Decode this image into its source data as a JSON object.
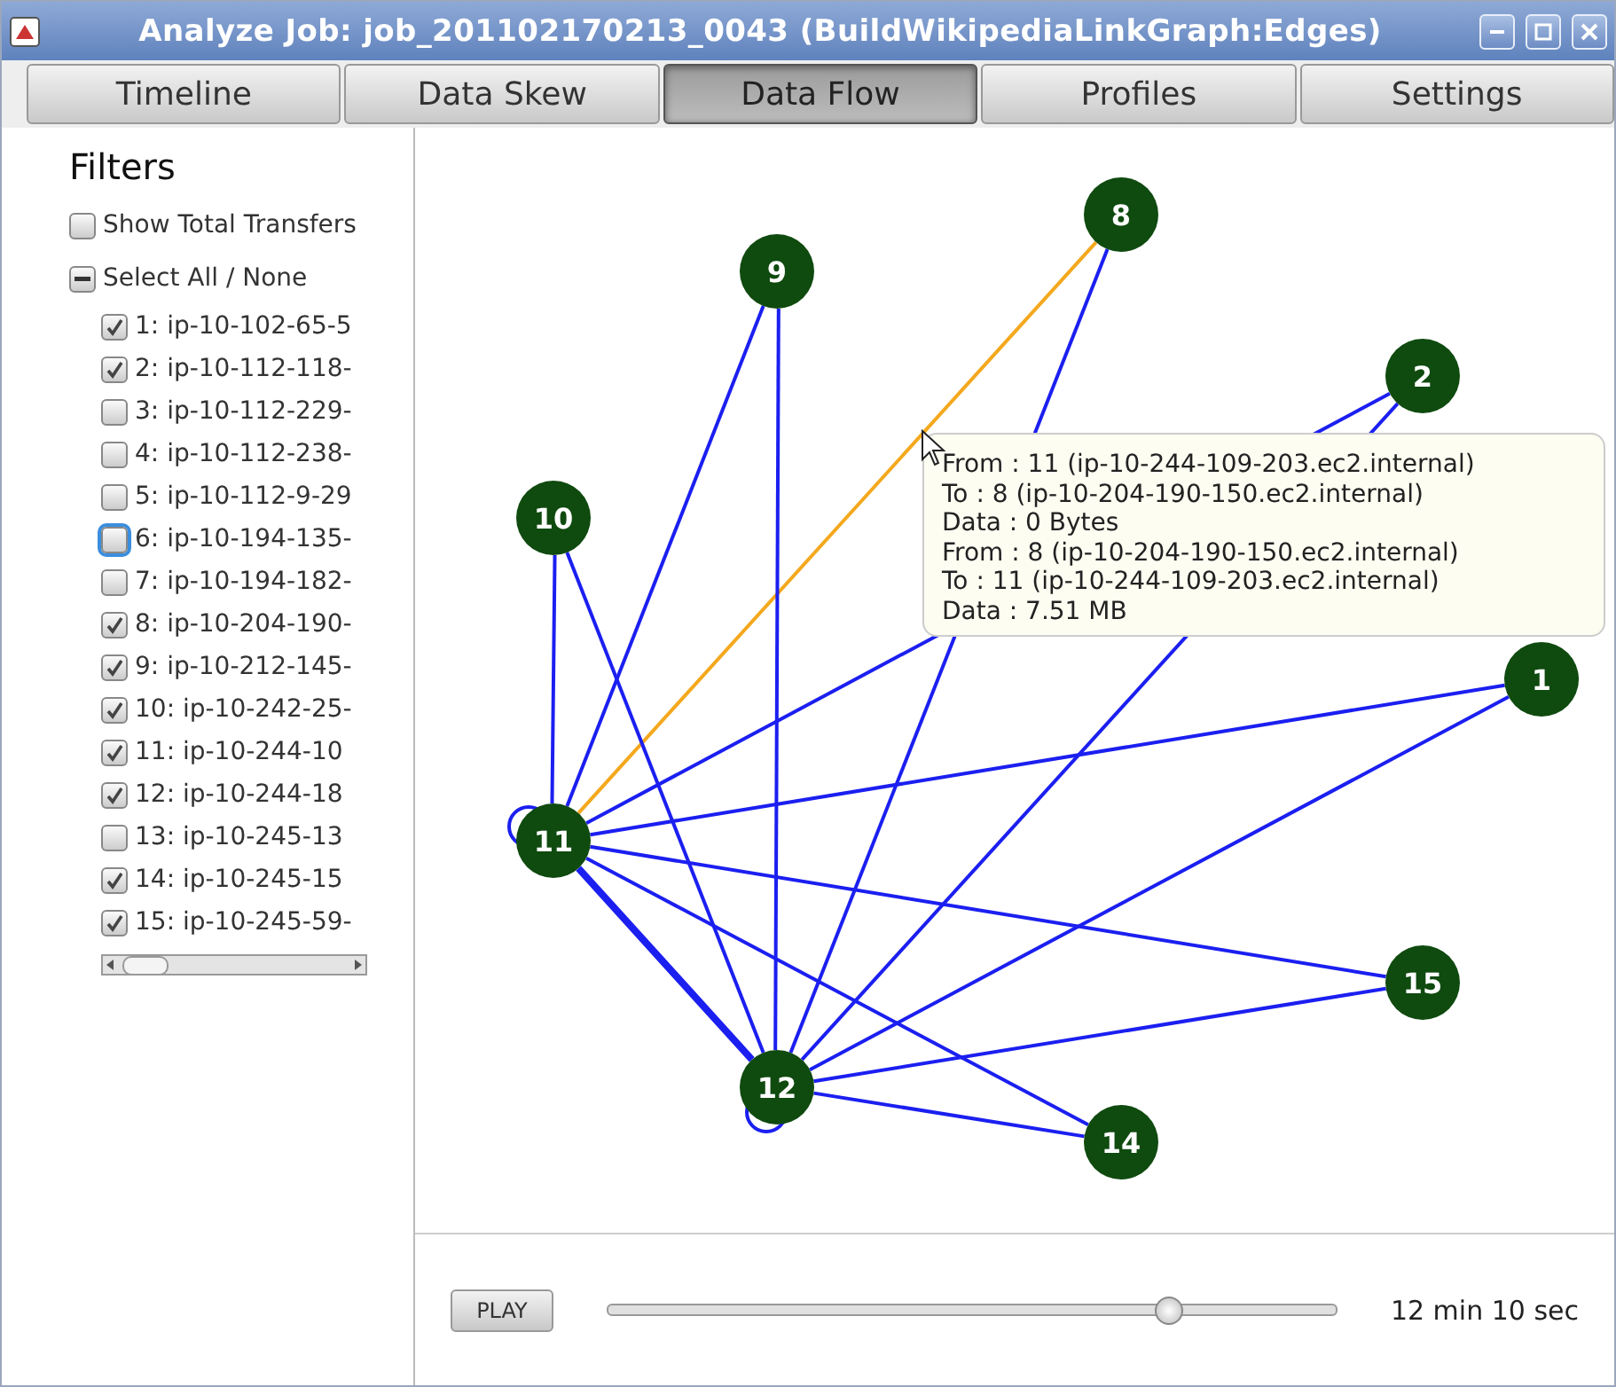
{
  "window": {
    "title": "Analyze Job: job_201102170213_0043 (BuildWikipediaLinkGraph:Edges)"
  },
  "tabs": [
    {
      "label": "Timeline",
      "selected": false
    },
    {
      "label": "Data Skew",
      "selected": false
    },
    {
      "label": "Data Flow",
      "selected": true
    },
    {
      "label": "Profiles",
      "selected": false
    },
    {
      "label": "Settings",
      "selected": false
    }
  ],
  "filters": {
    "title": "Filters",
    "show_total": {
      "label": "Show Total Transfers",
      "checked": false
    },
    "select_all": {
      "label": "Select All / None",
      "kind": "mixed"
    },
    "hosts": [
      {
        "label": "1: ip-10-102-65-5",
        "checked": true,
        "focused": false
      },
      {
        "label": "2: ip-10-112-118-",
        "checked": true,
        "focused": false
      },
      {
        "label": "3: ip-10-112-229-",
        "checked": false,
        "focused": false
      },
      {
        "label": "4: ip-10-112-238-",
        "checked": false,
        "focused": false
      },
      {
        "label": "5: ip-10-112-9-29",
        "checked": false,
        "focused": false
      },
      {
        "label": "6: ip-10-194-135-",
        "checked": false,
        "focused": true
      },
      {
        "label": "7: ip-10-194-182-",
        "checked": false,
        "focused": false
      },
      {
        "label": "8: ip-10-204-190-",
        "checked": true,
        "focused": false
      },
      {
        "label": "9: ip-10-212-145-",
        "checked": true,
        "focused": false
      },
      {
        "label": "10: ip-10-242-25-",
        "checked": true,
        "focused": false
      },
      {
        "label": "11: ip-10-244-10",
        "checked": true,
        "focused": false
      },
      {
        "label": "12: ip-10-244-18",
        "checked": true,
        "focused": false
      },
      {
        "label": "13: ip-10-245-13",
        "checked": false,
        "focused": false
      },
      {
        "label": "14: ip-10-245-15",
        "checked": true,
        "focused": false
      },
      {
        "label": "15: ip-10-245-59-",
        "checked": true,
        "focused": false
      }
    ]
  },
  "graph": {
    "nodes": [
      {
        "label": "8"
      },
      {
        "label": "9"
      },
      {
        "label": "2"
      },
      {
        "label": "10"
      },
      {
        "label": "1"
      },
      {
        "label": "11"
      },
      {
        "label": "15"
      },
      {
        "label": "12"
      },
      {
        "label": "14"
      }
    ],
    "edges": [
      {
        "kind": "line",
        "selected": true
      },
      {
        "kind": "line",
        "selected": false
      },
      {
        "kind": "line",
        "selected": false
      },
      {
        "kind": "line",
        "selected": false
      },
      {
        "kind": "line",
        "selected": false
      },
      {
        "kind": "line",
        "selected": false
      },
      {
        "kind": "heavy",
        "selected": false
      },
      {
        "kind": "line",
        "selected": false
      },
      {
        "kind": "line",
        "selected": false
      },
      {
        "kind": "line",
        "selected": false
      },
      {
        "kind": "line",
        "selected": false
      },
      {
        "kind": "line",
        "selected": false
      },
      {
        "kind": "line",
        "selected": false
      },
      {
        "kind": "line",
        "selected": false
      },
      {
        "kind": "line",
        "selected": false
      },
      {
        "kind": "loop",
        "selected": false
      },
      {
        "kind": "loop",
        "selected": false
      }
    ],
    "tooltip": [
      "From : 11 (ip-10-244-109-203.ec2.internal)",
      "To : 8 (ip-10-204-190-150.ec2.internal)",
      "Data : 0 Bytes",
      "From : 8 (ip-10-204-190-150.ec2.internal)",
      "To : 11 (ip-10-244-109-203.ec2.internal)",
      "Data :  7.51 MB"
    ]
  },
  "playback": {
    "button": "PLAY",
    "level": 0.77,
    "time": "12 min 10 sec"
  }
}
